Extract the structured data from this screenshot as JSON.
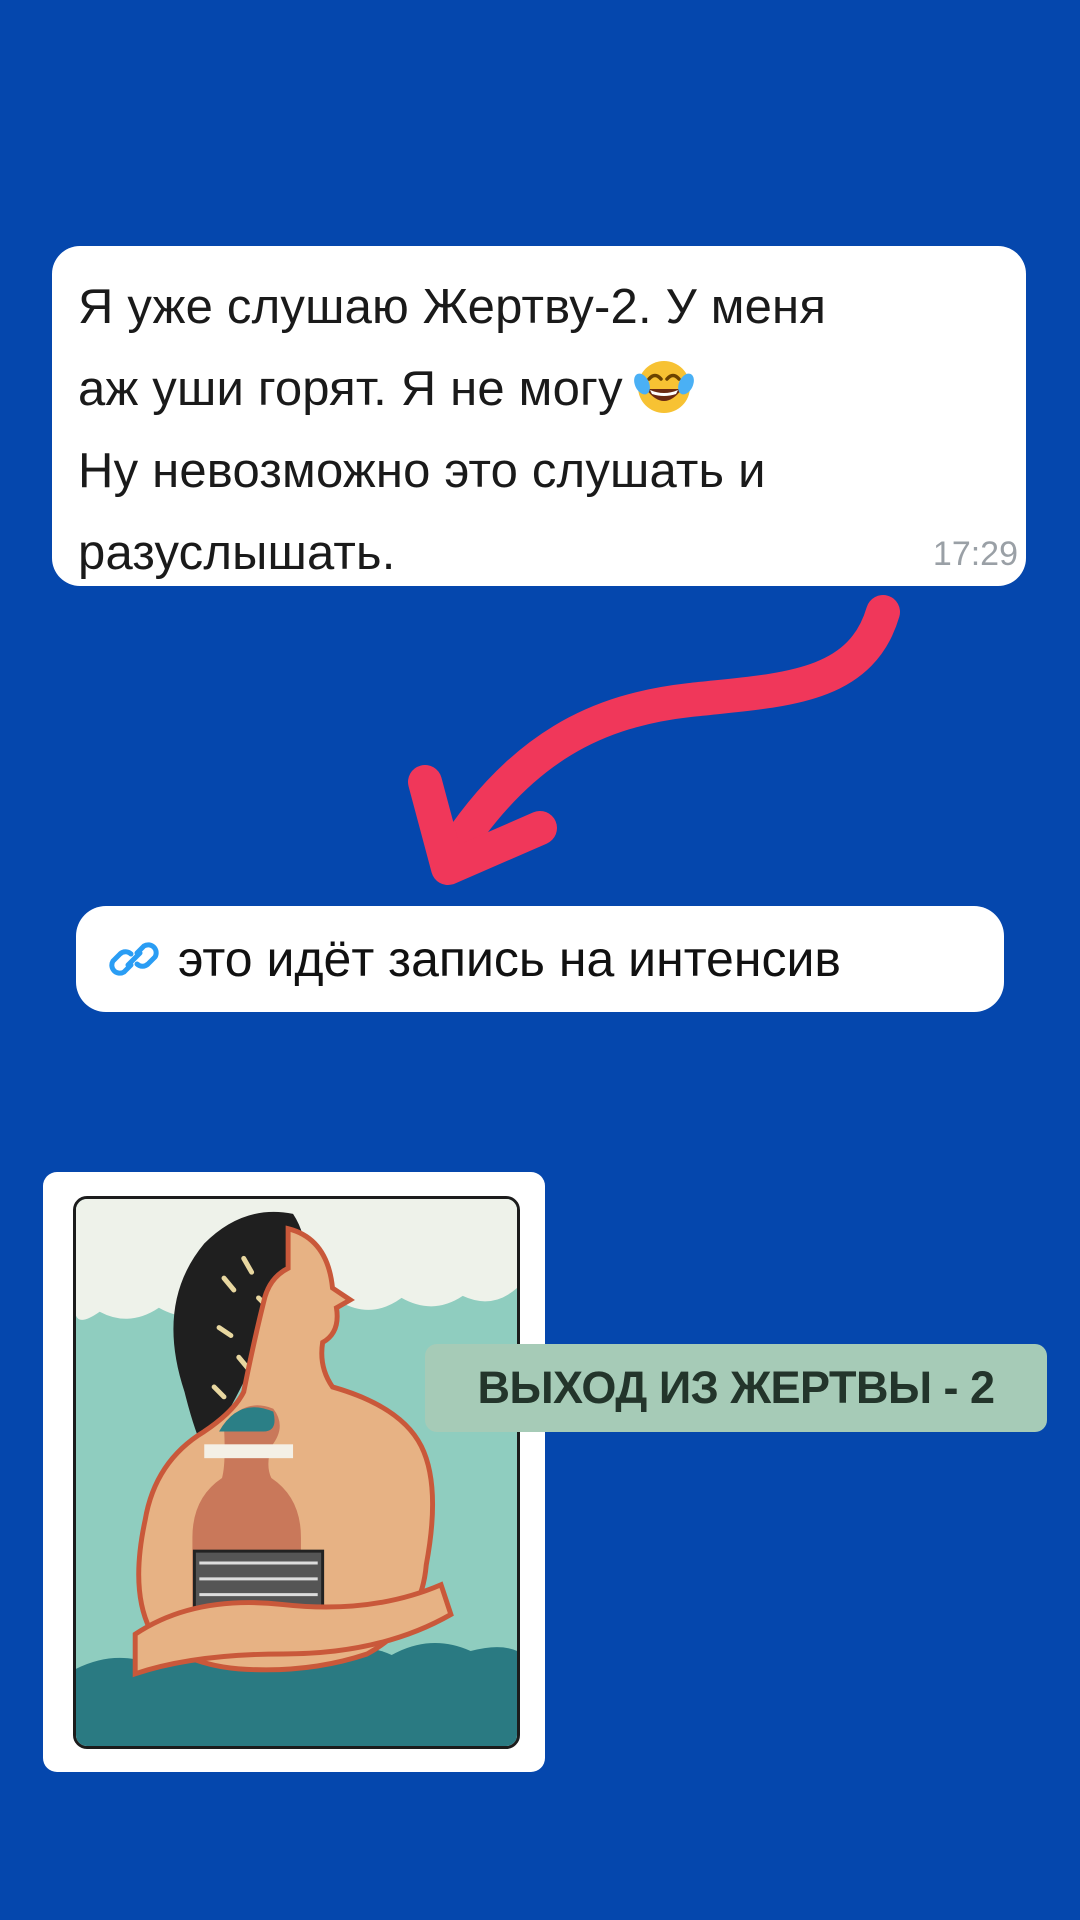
{
  "message": {
    "lines": [
      "Я уже слушаю Жертву-2. У меня",
      "аж уши горят. Я не могу",
      "Ну невозможно это слушать и",
      "разуслышать."
    ],
    "emoji": "face-with-tears-of-joy-icon",
    "time": "17:29"
  },
  "link": {
    "icon": "link-icon",
    "text": "это идёт запись на интенсив"
  },
  "course": {
    "title": "ВЫХОД ИЗ ЖЕРТВЫ - 2"
  },
  "colors": {
    "background": "#0547ad",
    "arrow": "#f0375a",
    "link_icon": "#2a9df4",
    "label_bg": "#a6cbb7",
    "label_text": "#23352b"
  }
}
